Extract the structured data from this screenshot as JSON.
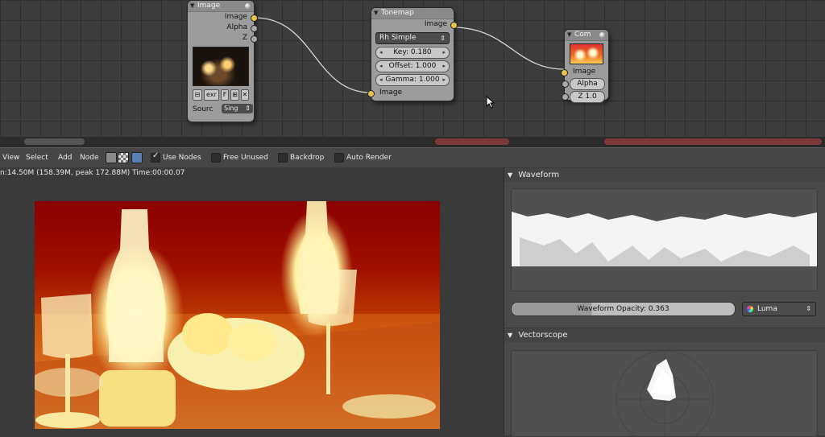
{
  "nodes": {
    "image": {
      "title": "Image",
      "outputs": [
        "Image",
        "Alpha",
        "Z"
      ],
      "tool_buttons": [
        "⊟",
        "exr",
        "F",
        "⊞",
        "✕"
      ],
      "source_label": "Sourc",
      "source_value": "Sing"
    },
    "tonemap": {
      "title": "Tonemap",
      "output": "Image",
      "type_select": "Rh Simple",
      "fields": [
        "Key: 0.180",
        "Offset: 1.000",
        "Gamma: 1.000"
      ],
      "input": "Image"
    },
    "composite": {
      "title": "Com",
      "inputs": [
        "Image",
        "Alpha",
        "Z 1.0"
      ]
    }
  },
  "header": {
    "menus": [
      "View",
      "Select",
      "Add",
      "Node"
    ],
    "toggles": [
      {
        "label": "Use Nodes",
        "checked": true
      },
      {
        "label": "Free Unused",
        "checked": false
      },
      {
        "label": "Backdrop",
        "checked": false
      },
      {
        "label": "Auto Render",
        "checked": false
      }
    ]
  },
  "viewer": {
    "memory_info": "n:14.50M (158.39M, peak 172.88M) Time:00:00.07"
  },
  "scopes": {
    "waveform_title": "Waveform",
    "waveform_opacity_label": "Waveform Opacity: 0.363",
    "waveform_opacity": 0.363,
    "mode": "Luma",
    "vectorscope_title": "Vectorscope"
  },
  "icons": {
    "collapse": "triangle-down-icon",
    "cursor": "mouse-pointer-icon"
  },
  "colors": {
    "socket_image": "#e8c34a",
    "socket_gray": "#a9a9a9",
    "wire": "#d9d9d9"
  }
}
